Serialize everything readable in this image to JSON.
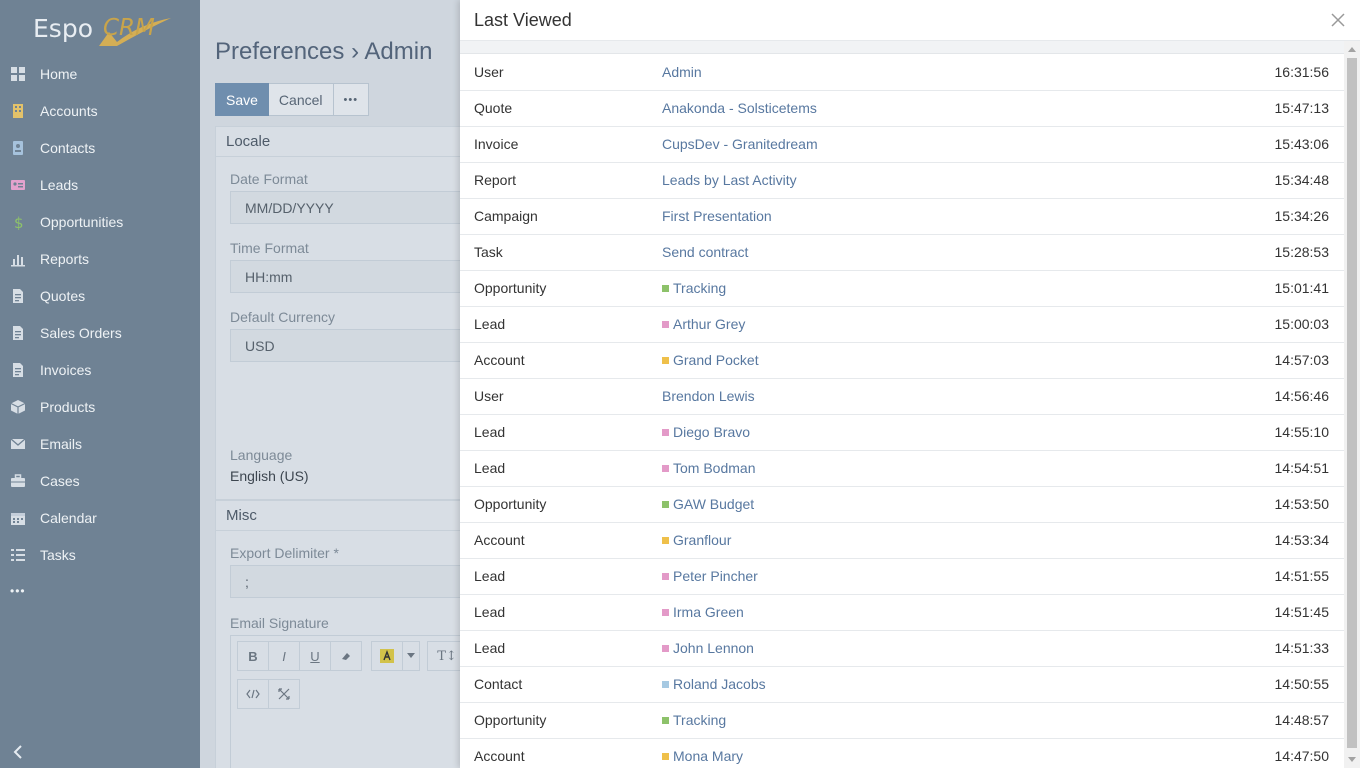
{
  "app": {
    "logo_espo": "Espo",
    "logo_crm": "CRM"
  },
  "sidebar": {
    "items": [
      {
        "label": "Home",
        "icon": "home-icon"
      },
      {
        "label": "Accounts",
        "icon": "building-icon"
      },
      {
        "label": "Contacts",
        "icon": "contact-card-icon"
      },
      {
        "label": "Leads",
        "icon": "id-card-icon"
      },
      {
        "label": "Opportunities",
        "icon": "dollar-icon"
      },
      {
        "label": "Reports",
        "icon": "bar-chart-icon"
      },
      {
        "label": "Quotes",
        "icon": "document-icon"
      },
      {
        "label": "Sales Orders",
        "icon": "document-icon"
      },
      {
        "label": "Invoices",
        "icon": "document-icon"
      },
      {
        "label": "Products",
        "icon": "cube-icon"
      },
      {
        "label": "Emails",
        "icon": "envelope-icon"
      },
      {
        "label": "Cases",
        "icon": "briefcase-icon"
      },
      {
        "label": "Calendar",
        "icon": "calendar-icon"
      },
      {
        "label": "Tasks",
        "icon": "tasks-icon"
      }
    ],
    "more_label": "•••"
  },
  "main": {
    "title": "Preferences › Admin",
    "buttons": {
      "save": "Save",
      "cancel": "Cancel",
      "more": "•••"
    },
    "locale": {
      "heading": "Locale",
      "date_format_label": "Date Format",
      "date_format_value": "MM/DD/YYYY",
      "time_format_label": "Time Format",
      "time_format_value": "HH:mm",
      "currency_label": "Default Currency",
      "currency_value": "USD",
      "language_label": "Language",
      "language_value": "English (US)"
    },
    "misc": {
      "heading": "Misc",
      "delimiter_label": "Export Delimiter *",
      "delimiter_value": ";",
      "signature_label": "Email Signature",
      "toolbar": {
        "bold": "B",
        "italic": "I",
        "underline": "U",
        "font": "T↕"
      }
    }
  },
  "modal": {
    "title": "Last Viewed",
    "rows": [
      {
        "type": "User",
        "name": "Admin",
        "time": "16:31:56",
        "color": ""
      },
      {
        "type": "Quote",
        "name": "Anakonda - Solsticetems",
        "time": "15:47:13",
        "color": ""
      },
      {
        "type": "Invoice",
        "name": "CupsDev - Granitedream",
        "time": "15:43:06",
        "color": ""
      },
      {
        "type": "Report",
        "name": "Leads by Last Activity",
        "time": "15:34:48",
        "color": ""
      },
      {
        "type": "Campaign",
        "name": "First Presentation",
        "time": "15:34:26",
        "color": ""
      },
      {
        "type": "Task",
        "name": "Send contract",
        "time": "15:28:53",
        "color": ""
      },
      {
        "type": "Opportunity",
        "name": "Tracking",
        "time": "15:01:41",
        "color": "#8dc26a"
      },
      {
        "type": "Lead",
        "name": "Arthur Grey",
        "time": "15:00:03",
        "color": "#e39ac8"
      },
      {
        "type": "Account",
        "name": "Grand Pocket",
        "time": "14:57:03",
        "color": "#efc04a"
      },
      {
        "type": "User",
        "name": "Brendon Lewis",
        "time": "14:56:46",
        "color": ""
      },
      {
        "type": "Lead",
        "name": "Diego Bravo",
        "time": "14:55:10",
        "color": "#e39ac8"
      },
      {
        "type": "Lead",
        "name": "Tom Bodman",
        "time": "14:54:51",
        "color": "#e39ac8"
      },
      {
        "type": "Opportunity",
        "name": "GAW Budget",
        "time": "14:53:50",
        "color": "#8dc26a"
      },
      {
        "type": "Account",
        "name": "Granflour",
        "time": "14:53:34",
        "color": "#efc04a"
      },
      {
        "type": "Lead",
        "name": "Peter Pincher",
        "time": "14:51:55",
        "color": "#e39ac8"
      },
      {
        "type": "Lead",
        "name": "Irma Green",
        "time": "14:51:45",
        "color": "#e39ac8"
      },
      {
        "type": "Lead",
        "name": "John Lennon",
        "time": "14:51:33",
        "color": "#e39ac8"
      },
      {
        "type": "Contact",
        "name": "Roland Jacobs",
        "time": "14:50:55",
        "color": "#a6c9e2"
      },
      {
        "type": "Opportunity",
        "name": "Tracking",
        "time": "14:48:57",
        "color": "#8dc26a"
      },
      {
        "type": "Account",
        "name": "Mona Mary",
        "time": "14:47:50",
        "color": "#efc04a"
      }
    ]
  }
}
